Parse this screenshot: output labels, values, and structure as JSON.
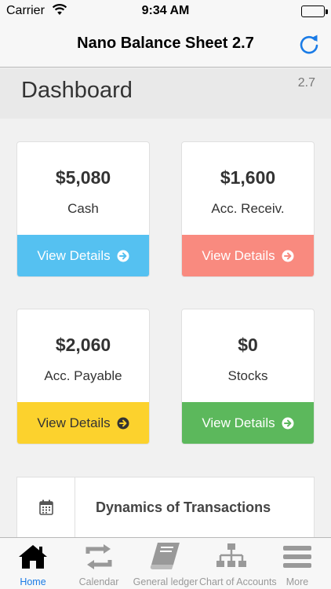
{
  "status_bar": {
    "carrier": "Carrier",
    "time": "9:34 AM"
  },
  "nav": {
    "title": "Nano Balance Sheet 2.7",
    "refresh_icon": "refresh-icon"
  },
  "header": {
    "title": "Dashboard",
    "version": "2.7"
  },
  "cards": [
    {
      "amount": "$5,080",
      "label": "Cash",
      "action": "View Details",
      "color": "#55c1f1"
    },
    {
      "amount": "$1,600",
      "label": "Acc. Receiv.",
      "action": "View Details",
      "color": "#f98a7f"
    },
    {
      "amount": "$2,060",
      "label": "Acc. Payable",
      "action": "View Details",
      "color": "#fcd22d"
    },
    {
      "amount": "$0",
      "label": "Stocks",
      "action": "View Details",
      "color": "#5cb85c"
    }
  ],
  "dynamics": {
    "label": "Dynamics of Transactions",
    "icon": "calendar-icon"
  },
  "tabs": [
    {
      "label": "Home",
      "icon": "home-icon",
      "active": true
    },
    {
      "label": "Calendar",
      "icon": "repeat-icon",
      "active": false
    },
    {
      "label": "General ledger",
      "icon": "book-icon",
      "active": false
    },
    {
      "label": "Chart of Accounts",
      "icon": "sitemap-icon",
      "active": false
    },
    {
      "label": "More",
      "icon": "menu-icon",
      "active": false
    }
  ],
  "colors": {
    "active_tab": "#1a7be6",
    "inactive_tab": "#999999"
  }
}
